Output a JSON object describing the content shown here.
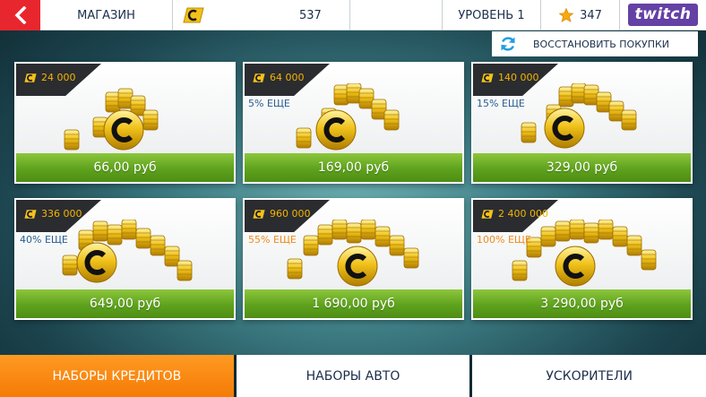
{
  "topbar": {
    "title": "МАГАЗИН",
    "credits": "537",
    "level": "УРОВЕНЬ 1",
    "stars": "347",
    "twitch_label": "twitch"
  },
  "restore_label": "ВОССТАНОВИТЬ ПОКУПКИ",
  "packs": [
    {
      "amount": "24 000",
      "bonus": "",
      "price": "66,00 руб"
    },
    {
      "amount": "64 000",
      "bonus": "5% ЕЩЕ",
      "price": "169,00 руб"
    },
    {
      "amount": "140 000",
      "bonus": "15% ЕЩЕ",
      "price": "329,00 руб"
    },
    {
      "amount": "336 000",
      "bonus": "40% ЕЩЕ",
      "price": "649,00 руб"
    },
    {
      "amount": "960 000",
      "bonus": "55% ЕЩЕ",
      "price": "1 690,00 руб"
    },
    {
      "amount": "2 400 000",
      "bonus": "100% ЕЩЕ",
      "price": "3 290,00 руб"
    }
  ],
  "tabs": [
    {
      "label": "НАБОРЫ КРЕДИТОВ",
      "active": true
    },
    {
      "label": "НАБОРЫ АВТО",
      "active": false
    },
    {
      "label": "УСКОРИТЕЛИ",
      "active": false
    }
  ],
  "colors": {
    "accent_red": "#e8262e",
    "buy_green": "#5ea21d",
    "active_tab_orange": "#f47b06",
    "gold": "#f5b400",
    "bonus_blue": "#2a5d8f",
    "bonus_orange": "#ee8a1e",
    "twitch_purple": "#6441a4"
  }
}
